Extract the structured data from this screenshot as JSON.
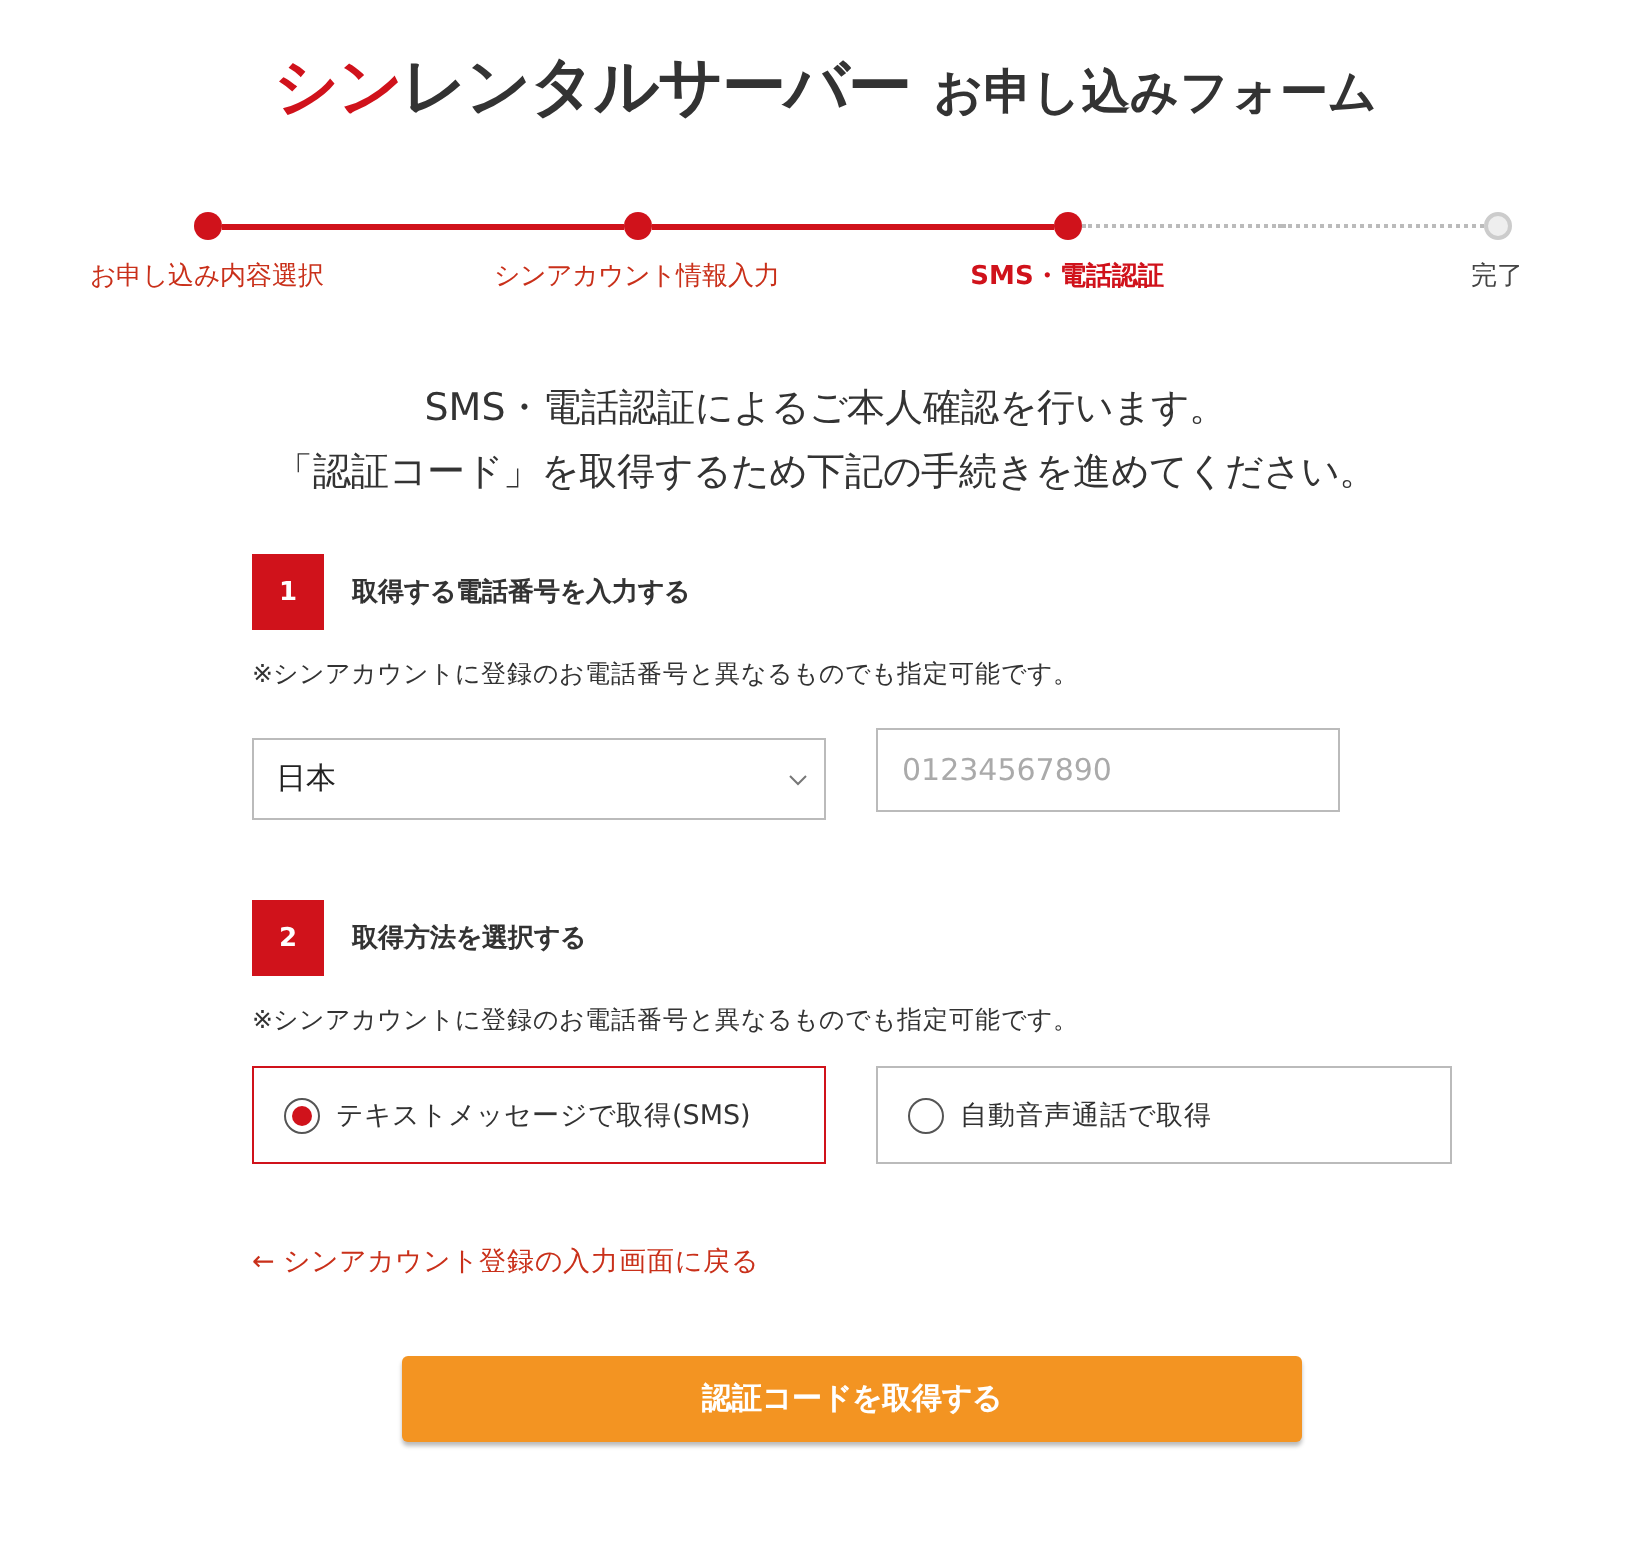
{
  "header": {
    "logo_accent": "シン",
    "logo_rest": "レンタルサーバー",
    "subtitle": "お申し込みフォーム"
  },
  "steps": [
    {
      "label": "お申し込み内容選択",
      "reached": true,
      "current": false
    },
    {
      "label": "シンアカウント情報入力",
      "reached": true,
      "current": false
    },
    {
      "label": "SMS・電話認証",
      "reached": true,
      "current": true
    },
    {
      "label": "完了",
      "reached": false,
      "current": false
    }
  ],
  "intro": [
    "SMS・電話認証によるご本人確認を行います。",
    "「認証コード」を取得するため下記の手続きを進めてください。"
  ],
  "section1": {
    "number": "1",
    "title": "取得する電話番号を入力する",
    "note": "※シンアカウントに登録のお電話番号と異なるものでも指定可能です。",
    "country": "日本",
    "phone_placeholder": "01234567890"
  },
  "section2": {
    "number": "2",
    "title": "取得方法を選択する",
    "note": "※シンアカウントに登録のお電話番号と異なるものでも指定可能です。",
    "options": [
      {
        "label": "テキストメッセージで取得(SMS)",
        "selected": true
      },
      {
        "label": "自動音声通話で取得",
        "selected": false
      }
    ]
  },
  "back_link": "← シンアカウント登録の入力画面に戻る",
  "submit": "認証コードを取得する"
}
